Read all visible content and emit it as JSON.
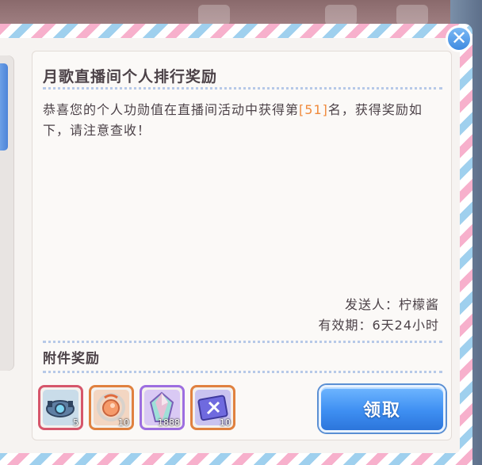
{
  "mail": {
    "title": "月歌直播间个人排行奖励",
    "body_prefix": "恭喜您的个人功勋值在直播间活动中获得第",
    "rank": "[51]",
    "body_suffix": "名，获得奖励如下，请注意查收！",
    "sender": "发送人：柠檬酱",
    "validity": "有效期：6天24小时"
  },
  "attachments": {
    "title": "附件奖励",
    "items": [
      {
        "name": "gear-item",
        "count": "5",
        "border": "#d6566b",
        "fill": "#c9dce9"
      },
      {
        "name": "peach-item",
        "count": "10",
        "border": "#e0813f",
        "fill": "#f3d6c2"
      },
      {
        "name": "crystal-item",
        "count": "1888",
        "border": "#9d6ee0",
        "fill": "#d9c9f4"
      },
      {
        "name": "ticket-item",
        "count": "10",
        "border": "#e0813f",
        "fill": "#c9c3f0"
      }
    ]
  },
  "buttons": {
    "claim_label": "领取",
    "close_label": "✕"
  }
}
